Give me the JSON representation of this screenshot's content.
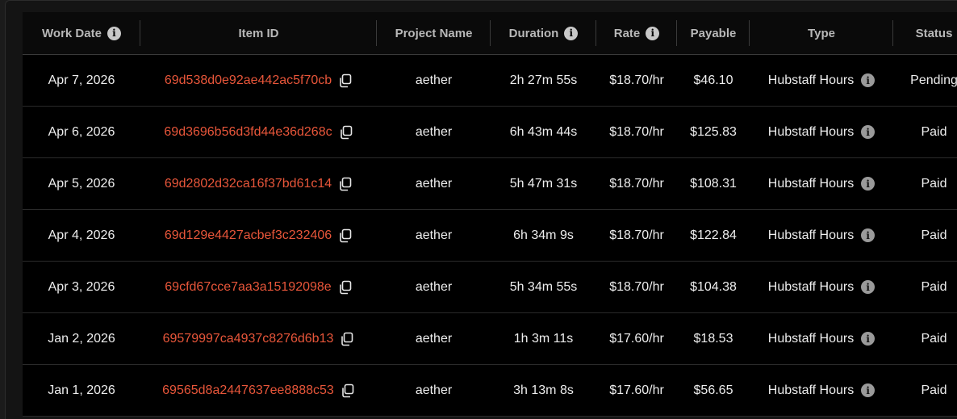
{
  "columns": [
    {
      "label": "Work Date",
      "info": true
    },
    {
      "label": "Item ID",
      "info": false
    },
    {
      "label": "Project Name",
      "info": false
    },
    {
      "label": "Duration",
      "info": true
    },
    {
      "label": "Rate",
      "info": true
    },
    {
      "label": "Payable",
      "info": false
    },
    {
      "label": "Type",
      "info": false
    },
    {
      "label": "Status",
      "info": false
    }
  ],
  "rows": [
    {
      "date": "Apr 7, 2026",
      "item_id": "69d538d0e92ae442ac5f70cb",
      "project": "aether",
      "duration": "2h 27m 55s",
      "rate": "$18.70/hr",
      "payable": "$46.10",
      "type": "Hubstaff Hours",
      "status": "Pending"
    },
    {
      "date": "Apr 6, 2026",
      "item_id": "69d3696b56d3fd44e36d268c",
      "project": "aether",
      "duration": "6h 43m 44s",
      "rate": "$18.70/hr",
      "payable": "$125.83",
      "type": "Hubstaff Hours",
      "status": "Paid"
    },
    {
      "date": "Apr 5, 2026",
      "item_id": "69d2802d32ca16f37bd61c14",
      "project": "aether",
      "duration": "5h 47m 31s",
      "rate": "$18.70/hr",
      "payable": "$108.31",
      "type": "Hubstaff Hours",
      "status": "Paid"
    },
    {
      "date": "Apr 4, 2026",
      "item_id": "69d129e4427acbef3c232406",
      "project": "aether",
      "duration": "6h 34m 9s",
      "rate": "$18.70/hr",
      "payable": "$122.84",
      "type": "Hubstaff Hours",
      "status": "Paid"
    },
    {
      "date": "Apr 3, 2026",
      "item_id": "69cfd67cce7aa3a15192098e",
      "project": "aether",
      "duration": "5h 34m 55s",
      "rate": "$18.70/hr",
      "payable": "$104.38",
      "type": "Hubstaff Hours",
      "status": "Paid"
    },
    {
      "date": "Jan 2, 2026",
      "item_id": "69579997ca4937c8276d6b13",
      "project": "aether",
      "duration": "1h 3m 11s",
      "rate": "$17.60/hr",
      "payable": "$18.53",
      "type": "Hubstaff Hours",
      "status": "Paid"
    },
    {
      "date": "Jan 1, 2026",
      "item_id": "69565d8a2447637ee8888c53",
      "project": "aether",
      "duration": "3h 13m 8s",
      "rate": "$17.60/hr",
      "payable": "$56.65",
      "type": "Hubstaff Hours",
      "status": "Paid"
    }
  ],
  "icons": {
    "info": "info-icon",
    "copy": "copy-icon"
  },
  "colors": {
    "link": "#e8563a",
    "background": "#000000",
    "header_text": "#b8b8b8"
  }
}
